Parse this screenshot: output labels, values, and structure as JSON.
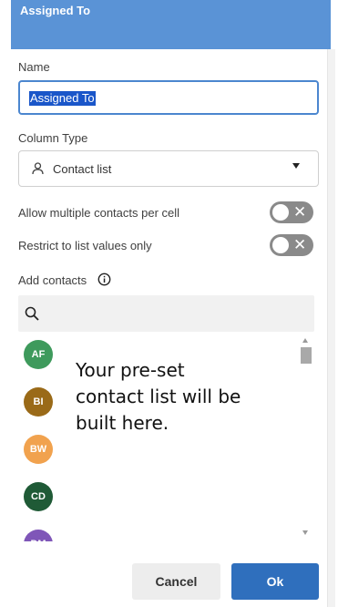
{
  "header": {
    "title": "Assigned To"
  },
  "name_field": {
    "label": "Name",
    "value": "Assigned To"
  },
  "column_type": {
    "label": "Column Type",
    "selected": "Contact list"
  },
  "toggles": [
    {
      "label": "Allow multiple contacts per cell",
      "state": "off"
    },
    {
      "label": "Restrict to list values only",
      "state": "off"
    }
  ],
  "contacts": {
    "label": "Add contacts",
    "search_placeholder": "",
    "items": [
      {
        "initials": "AF",
        "color": "#3e9a5c"
      },
      {
        "initials": "BI",
        "color": "#9a6a18"
      },
      {
        "initials": "BW",
        "color": "#f1a24e"
      },
      {
        "initials": "CD",
        "color": "#1f5a36"
      },
      {
        "initials": "DM",
        "color": "#7f56b8"
      }
    ],
    "note": "Your pre-set contact list will be built here."
  },
  "buttons": {
    "cancel": "Cancel",
    "ok": "Ok"
  },
  "colors": {
    "header": "#5a93d6",
    "primary": "#2f6fbd",
    "focus": "#4b86cf"
  }
}
